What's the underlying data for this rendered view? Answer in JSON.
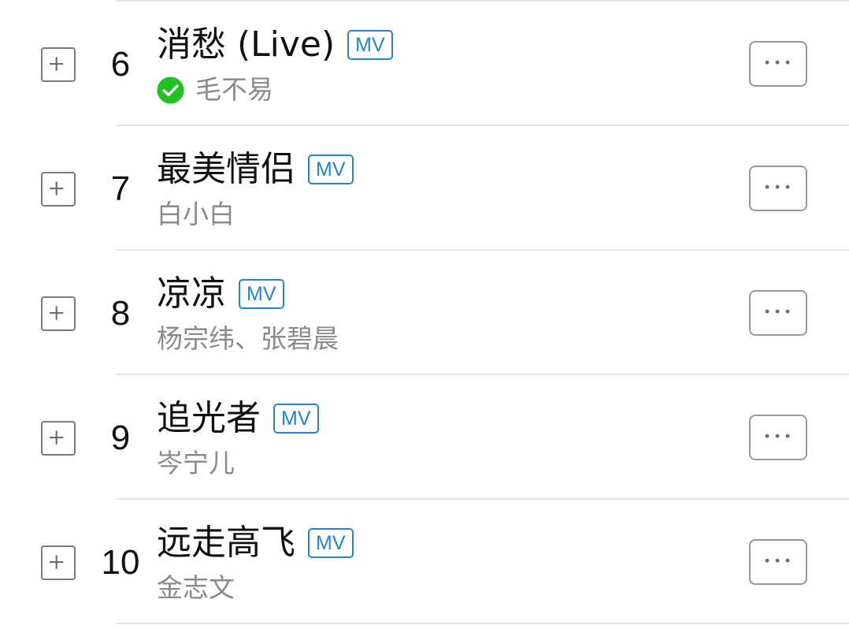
{
  "songs": [
    {
      "rank": "6",
      "title": "消愁 (Live)",
      "mv_label": "MV",
      "artist": "毛不易",
      "verified": true
    },
    {
      "rank": "7",
      "title": "最美情侣",
      "mv_label": "MV",
      "artist": "白小白",
      "verified": false
    },
    {
      "rank": "8",
      "title": "凉凉",
      "mv_label": "MV",
      "artist": "杨宗纬、张碧晨",
      "verified": false
    },
    {
      "rank": "9",
      "title": "追光者",
      "mv_label": "MV",
      "artist": "岑宁儿",
      "verified": false
    },
    {
      "rank": "10",
      "title": "远走高飞",
      "mv_label": "MV",
      "artist": "金志文",
      "verified": false
    }
  ],
  "colors": {
    "mv_badge": "#1f86d6",
    "verified": "#1fc21f",
    "artist_text": "#8a8a8a",
    "divider": "#e6e6e6"
  },
  "icons": {
    "add": "plus-square-icon",
    "verified": "check-circle-icon",
    "more": "ellipsis-icon"
  }
}
